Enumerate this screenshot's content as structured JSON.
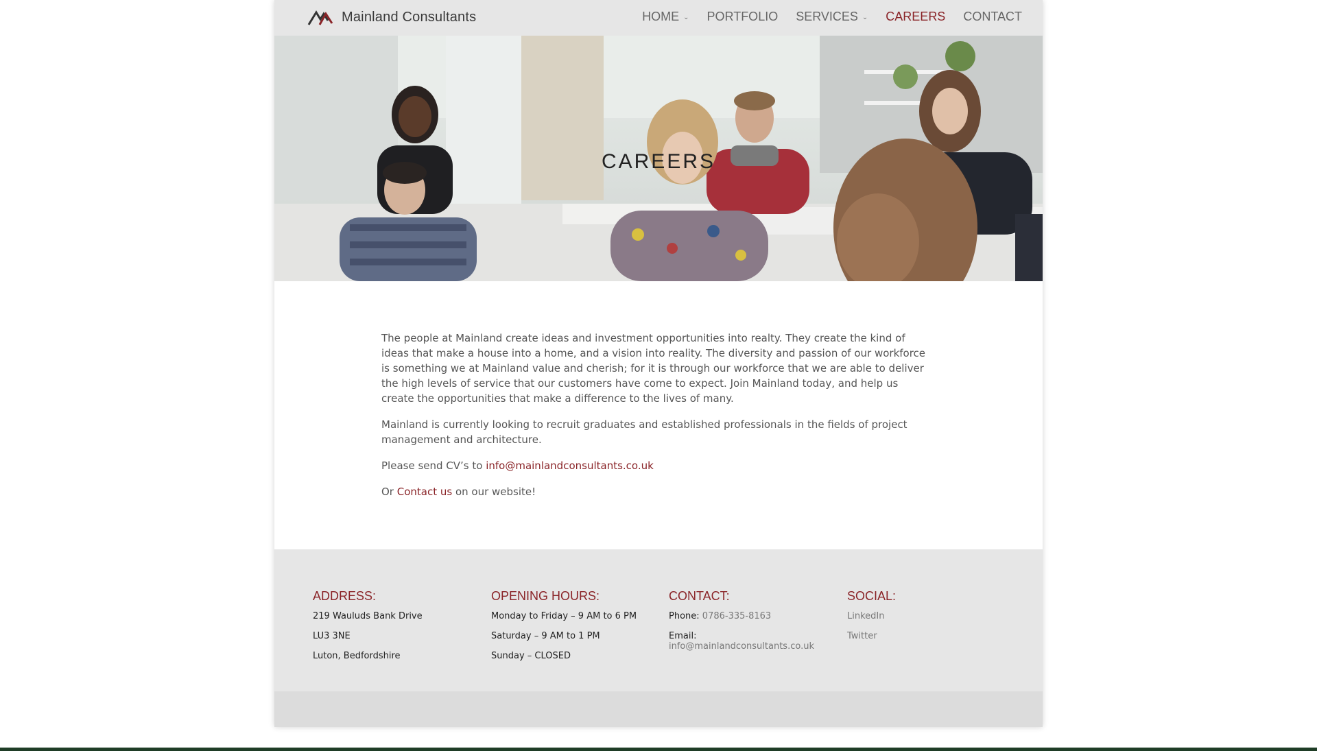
{
  "header": {
    "logo_text": "Mainland Consultants",
    "nav": [
      {
        "label": "HOME",
        "has_dropdown": true
      },
      {
        "label": "PORTFOLIO",
        "has_dropdown": false
      },
      {
        "label": "SERVICES",
        "has_dropdown": true
      },
      {
        "label": "CAREERS",
        "has_dropdown": false,
        "active": true
      },
      {
        "label": "CONTACT",
        "has_dropdown": false
      }
    ]
  },
  "hero": {
    "title": "CAREERS"
  },
  "content": {
    "p1": "The people at Mainland create ideas and investment opportunities into realty. They create the kind of ideas that make a house into a home, and a vision into reality. The diversity and passion of our workforce is something we at Mainland value and cherish; for it is through our workforce that we are able to deliver the high levels of service that our customers have come to expect.  Join Mainland today, and help us create the opportunities that make a difference to the lives of many.",
    "p2": "Mainland is currently looking to recruit graduates and established professionals in the fields of project management and architecture.",
    "p3_prefix": "Please send CV’s to ",
    "p3_email": "info@mainlandconsultants.co.uk",
    "p4_prefix": "Or ",
    "p4_link": "Contact us",
    "p4_suffix": " on our website!"
  },
  "footer": {
    "address": {
      "heading": "ADDRESS:",
      "lines": [
        "219 Wauluds Bank Drive",
        "LU3 3NE",
        "Luton, Bedfordshire"
      ]
    },
    "hours": {
      "heading": "OPENING HOURS:",
      "lines": [
        "Monday to Friday – 9 AM to 6 PM",
        "Saturday – 9 AM to 1 PM",
        "Sunday – CLOSED"
      ]
    },
    "contact": {
      "heading": "CONTACT:",
      "phone_label": "Phone:",
      "phone_value": "0786-335-8163",
      "email_label": "Email:",
      "email_value": "info@mainlandconsultants.co.uk"
    },
    "social": {
      "heading": "SOCIAL:",
      "links": [
        "LinkedIn",
        "Twitter"
      ]
    }
  },
  "colors": {
    "accent": "#8a2428",
    "bar_bg": "#e6e6e6",
    "text": "#555555"
  },
  "icons": {
    "logo": "mountain-logo-icon",
    "dropdown": "chevron-down-icon"
  }
}
